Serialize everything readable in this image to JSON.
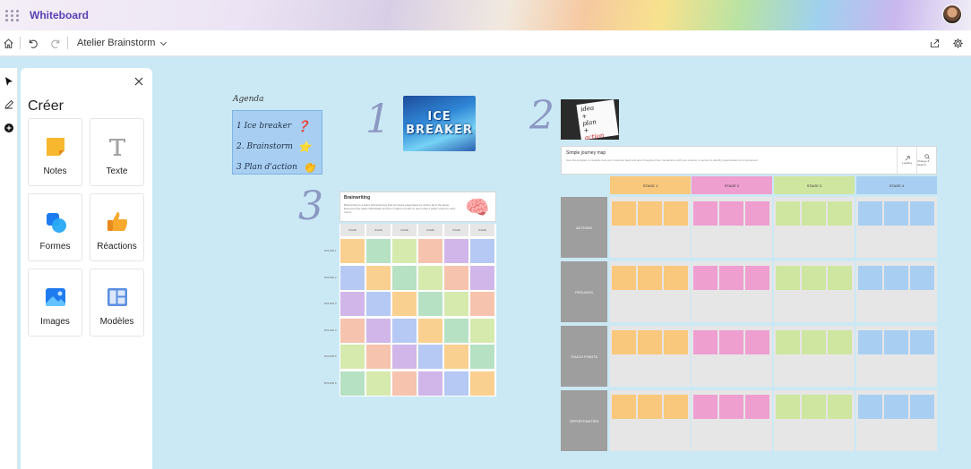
{
  "titlebar": {
    "app_title": "Whiteboard",
    "avatar_label": "user-avatar"
  },
  "toolbar": {
    "home_icon": "home-icon",
    "undo_icon": "undo-icon",
    "redo_icon": "redo-icon",
    "board_name": "Atelier Brainstorm",
    "share_icon": "share-icon",
    "settings_icon": "gear-icon"
  },
  "rail": {
    "items": [
      "select-icon",
      "pen-icon",
      "add-icon"
    ]
  },
  "create_panel": {
    "title": "Créer",
    "tiles": [
      {
        "label": "Notes",
        "icon": "notes-icon"
      },
      {
        "label": "Texte",
        "icon": "text-icon"
      },
      {
        "label": "Formes",
        "icon": "shapes-icon"
      },
      {
        "label": "Réactions",
        "icon": "reactions-icon"
      },
      {
        "label": "Images",
        "icon": "images-icon"
      },
      {
        "label": "Modèles",
        "icon": "templates-icon"
      }
    ]
  },
  "canvas": {
    "agenda": {
      "title": "Agenda",
      "items": [
        {
          "text": "1  Ice breaker",
          "emoji": "❓"
        },
        {
          "text": "2. Brainstorm",
          "emoji": "⭐"
        },
        {
          "text": "3  Plan d'action",
          "emoji": "👏"
        }
      ]
    },
    "numerals": [
      "1",
      "2",
      "3"
    ],
    "ice_breaker_image": {
      "text_line1": "ICE",
      "text_line2": "BREAKER"
    },
    "idea_image": {
      "lines": [
        "idea",
        "+",
        "plan",
        "+",
        "action"
      ]
    },
    "brainwriting": {
      "title": "Brainwriting",
      "description": "Brainwriting is a silent brainstorming that promotes equal ideas by writing all of the ideas. Everyone has ideas individually and then rotates to build on each other's sticky notes for each round.",
      "col_headers": [
        "NAME",
        "NAME",
        "NAME",
        "NAME",
        "NAME",
        "NAME"
      ],
      "row_labels": [
        "ROUND 1",
        "ROUND 2",
        "ROUND 3",
        "ROUND 4",
        "ROUND 5",
        "ROUND 6"
      ]
    },
    "journey_map": {
      "title": "Simple journey map",
      "description": "Use this template to visualize how your customer feels and acts throughout their interactions with your product or service to identify opportunities for improvement.",
      "buttons": [
        {
          "label": "Loading"
        },
        {
          "label": "Change & Search"
        }
      ],
      "stages": [
        {
          "label": "STAGE 1",
          "color": "#f9c87c"
        },
        {
          "label": "STAGE 2",
          "color": "#ee9fd0"
        },
        {
          "label": "STAGE 3",
          "color": "#cfe6a0"
        },
        {
          "label": "STAGE 4",
          "color": "#a8cff1"
        }
      ],
      "rows": [
        "ACTIONS",
        "FEELINGS",
        "TOUCH POINTS",
        "OPPORTUNITIES"
      ]
    }
  }
}
